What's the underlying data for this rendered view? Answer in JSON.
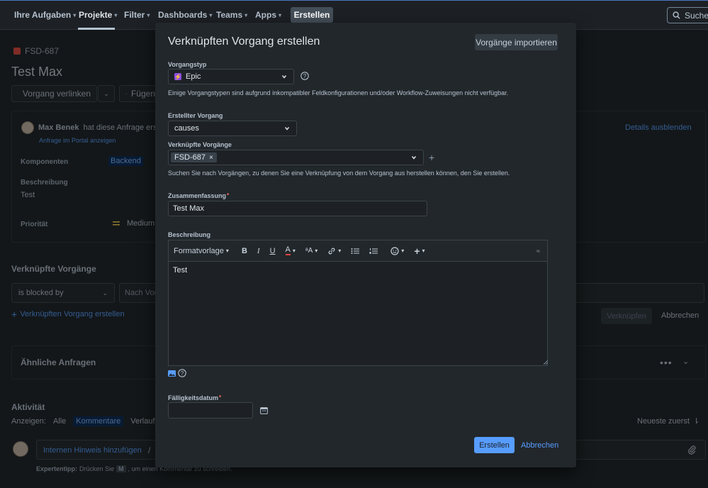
{
  "nav": {
    "items": [
      "Ihre Aufgaben",
      "Projekte",
      "Filter",
      "Dashboards",
      "Teams",
      "Apps"
    ],
    "create": "Erstellen",
    "search": "Suchen"
  },
  "issue": {
    "key": "FSD-687",
    "title": "Test Max",
    "link_button": "Vorgang verlinken",
    "add_button": "Fügen",
    "reporter_name": "Max Benek",
    "reporter_text": "hat diese Anfrage erste",
    "portal_link": "Anfrage im Portal anzeigen",
    "hide_details": "Details ausblenden",
    "components_label": "Komponenten",
    "components_value": "Backend",
    "description_label": "Beschreibung",
    "description_value": "Test",
    "priority_label": "Priorität",
    "priority_value": "Medium"
  },
  "linked": {
    "title": "Verknüpfte Vorgänge",
    "relation": "is blocked by",
    "search_placeholder": "Nach Vor",
    "create_link": "Verknüpften Vorgang erstellen",
    "link_btn": "Verknüpfen",
    "cancel_btn": "Abbrechen"
  },
  "similar": {
    "title": "Ähnliche Anfragen"
  },
  "activity": {
    "title": "Aktivität",
    "show_label": "Anzeigen:",
    "filter_all": "Alle",
    "filter_comments": "Kommentare",
    "filter_history": "Verlauf",
    "sort": "Neueste zuerst",
    "internal_note": "Internen Hinweis hinzufügen",
    "slash": "/",
    "tip_bold": "Expertentipp:",
    "tip_text": "Drücken Sie",
    "tip_key": "M",
    "tip_text2": ", um einen Kommentar zu schreiben."
  },
  "modal": {
    "title": "Verknüpften Vorgang erstellen",
    "import": "Vorgänge importieren",
    "type_label": "Vorgangstyp",
    "type_value": "Epic",
    "type_help": "Einige Vorgangstypen sind aufgrund inkompatibler Feldkonfigurationen und/oder Workflow-Zuweisungen nicht verfügbar.",
    "created_label": "Erstellter Vorgang",
    "created_value": "causes",
    "linked_label": "Verknüpfte Vorgänge",
    "linked_tag": "FSD-687",
    "linked_help": "Suchen Sie nach Vorgängen, zu denen Sie eine Verknüpfung von dem Vorgang aus herstellen können, den Sie erstellen.",
    "summary_label": "Zusammenfassung",
    "summary_value": "Test Max",
    "desc_label": "Beschreibung",
    "format": "Formatvorlage",
    "desc_value": "Test",
    "due_label": "Fälligkeitsdatum",
    "submit": "Erstellen",
    "cancel": "Abbrechen"
  },
  "colors": {
    "accent": "#579dff",
    "epic": "#904ee2",
    "required": "#f87168",
    "priority": "#f5cd47"
  }
}
